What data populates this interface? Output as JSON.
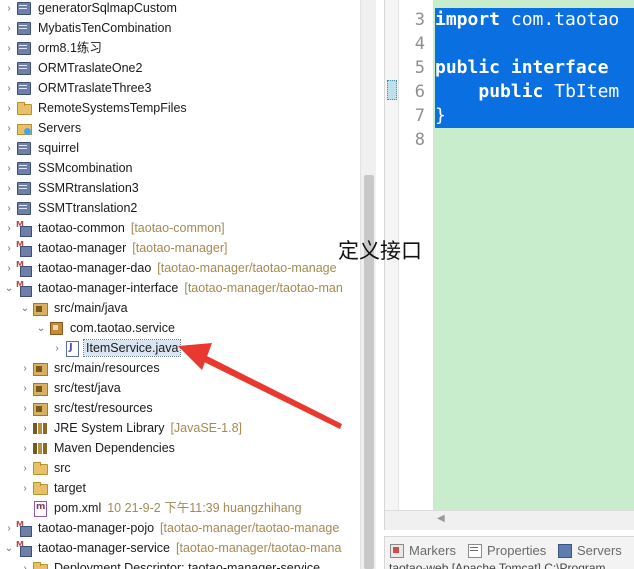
{
  "explorer": {
    "rows": [
      {
        "label": "generatorSqlmapCustom",
        "decoration": "",
        "icon": "project-icon",
        "chevron": ">"
      },
      {
        "label": "MybatisTenCombination",
        "decoration": "",
        "icon": "project-icon",
        "chevron": ">"
      },
      {
        "label": "orm8.1练习",
        "decoration": "",
        "icon": "project-icon",
        "chevron": ">"
      },
      {
        "label": "ORMTraslateOne2",
        "decoration": "",
        "icon": "project-icon",
        "chevron": ">"
      },
      {
        "label": "ORMTraslateThree3",
        "decoration": "",
        "icon": "project-icon",
        "chevron": ">"
      },
      {
        "label": "RemoteSystemsTempFiles",
        "decoration": "",
        "icon": "folder-icon",
        "chevron": ">"
      },
      {
        "label": "Servers",
        "decoration": "",
        "icon": "server-icon",
        "chevron": ">"
      },
      {
        "label": "squirrel",
        "decoration": "",
        "icon": "project-icon",
        "chevron": ">"
      },
      {
        "label": "SSMcombination",
        "decoration": "",
        "icon": "project-icon",
        "chevron": ">"
      },
      {
        "label": "SSMRtranslation3",
        "decoration": "",
        "icon": "project-icon",
        "chevron": ">"
      },
      {
        "label": "SSMTtranslation2",
        "decoration": "",
        "icon": "project-icon",
        "chevron": ">"
      },
      {
        "label": "taotao-common",
        "decoration": "[taotao-common]",
        "icon": "maven-project-icon",
        "chevron": ">"
      },
      {
        "label": "taotao-manager",
        "decoration": "[taotao-manager]",
        "icon": "maven-project-icon",
        "chevron": ">"
      },
      {
        "label": "taotao-manager-dao",
        "decoration": "[taotao-manager/taotao-manage",
        "icon": "maven-project-icon",
        "chevron": ">"
      },
      {
        "label": "taotao-manager-interface",
        "decoration": "[taotao-manager/taotao-man",
        "icon": "maven-project-icon",
        "chevron": "v"
      },
      {
        "label": "src/main/java",
        "decoration": "",
        "icon": "source-folder-icon",
        "chevron": "v"
      },
      {
        "label": "com.taotao.service",
        "decoration": "",
        "icon": "package-icon",
        "chevron": "v"
      },
      {
        "label": "ItemService.java",
        "decoration": "",
        "icon": "java-file-icon",
        "chevron": ">",
        "selected": true
      },
      {
        "label": "src/main/resources",
        "decoration": "",
        "icon": "source-folder-icon",
        "chevron": ">"
      },
      {
        "label": "src/test/java",
        "decoration": "",
        "icon": "source-folder-icon",
        "chevron": ">"
      },
      {
        "label": "src/test/resources",
        "decoration": "",
        "icon": "source-folder-icon",
        "chevron": ">"
      },
      {
        "label": "JRE System Library",
        "decoration": "[JavaSE-1.8]",
        "icon": "library-icon",
        "chevron": ">"
      },
      {
        "label": "Maven Dependencies",
        "decoration": "",
        "icon": "library-icon",
        "chevron": ">"
      },
      {
        "label": "src",
        "decoration": "",
        "icon": "folder-icon",
        "chevron": ">"
      },
      {
        "label": "target",
        "decoration": "",
        "icon": "folder-icon",
        "chevron": ">"
      },
      {
        "label": "pom.xml",
        "decoration": "10  21-9-2 下午11:39  huangzhihang",
        "icon": "xml-file-icon",
        "chevron": ""
      },
      {
        "label": "taotao-manager-pojo",
        "decoration": "[taotao-manager/taotao-manage",
        "icon": "maven-project-icon",
        "chevron": ">"
      },
      {
        "label": "taotao-manager-service",
        "decoration": "[taotao-manager/taotao-mana",
        "icon": "maven-project-icon",
        "chevron": "v"
      },
      {
        "label": "Deployment Descriptor: taotao-manager-service",
        "decoration": "",
        "icon": "folder-icon",
        "chevron": ">"
      }
    ]
  },
  "editor": {
    "line_numbers": [
      "3",
      "4",
      "5",
      "6",
      "7",
      "8"
    ],
    "code_lines": [
      {
        "text": "import com.taotao",
        "selected": true
      },
      {
        "text": "",
        "selected": true
      },
      {
        "text": "public interface ",
        "selected": true
      },
      {
        "text": "    public TbItem",
        "selected": true
      },
      {
        "text": "}",
        "selected": true
      },
      {
        "text": "",
        "selected": false
      }
    ]
  },
  "bottom_panel": {
    "tabs": [
      {
        "label": "Markers",
        "icon": "markers-icon"
      },
      {
        "label": "Properties",
        "icon": "properties-icon"
      },
      {
        "label": "Servers",
        "icon": "servers-icon"
      }
    ],
    "console_preview": "taotao-web [Apache Tomcat] C:\\Program"
  },
  "annotation": {
    "text": "定义接口",
    "arrow_color": "#e8382f"
  },
  "colors": {
    "code_background": "#c7edcc",
    "selection": "#0a6fe0",
    "decoration": "#a48a52"
  }
}
